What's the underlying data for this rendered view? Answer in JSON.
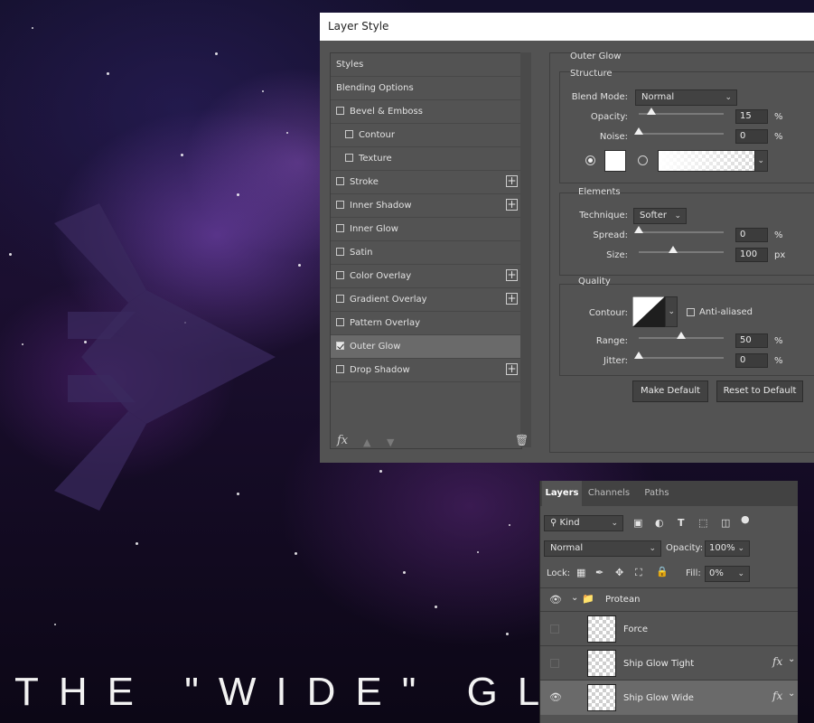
{
  "canvas": {
    "headline": "THE \"WIDE\" GLOW"
  },
  "layer_style": {
    "window_title": "Layer Style",
    "styles_list": [
      {
        "label": "Styles",
        "checkbox": false,
        "checked": false,
        "plus": false,
        "indent": 0,
        "selected": false
      },
      {
        "label": "Blending Options",
        "checkbox": false,
        "checked": false,
        "plus": false,
        "indent": 0,
        "selected": false
      },
      {
        "label": "Bevel & Emboss",
        "checkbox": true,
        "checked": false,
        "plus": false,
        "indent": 0,
        "selected": false
      },
      {
        "label": "Contour",
        "checkbox": true,
        "checked": false,
        "plus": false,
        "indent": 1,
        "selected": false
      },
      {
        "label": "Texture",
        "checkbox": true,
        "checked": false,
        "plus": false,
        "indent": 1,
        "selected": false
      },
      {
        "label": "Stroke",
        "checkbox": true,
        "checked": false,
        "plus": true,
        "indent": 0,
        "selected": false
      },
      {
        "label": "Inner Shadow",
        "checkbox": true,
        "checked": false,
        "plus": true,
        "indent": 0,
        "selected": false
      },
      {
        "label": "Inner Glow",
        "checkbox": true,
        "checked": false,
        "plus": false,
        "indent": 0,
        "selected": false
      },
      {
        "label": "Satin",
        "checkbox": true,
        "checked": false,
        "plus": false,
        "indent": 0,
        "selected": false
      },
      {
        "label": "Color Overlay",
        "checkbox": true,
        "checked": false,
        "plus": true,
        "indent": 0,
        "selected": false
      },
      {
        "label": "Gradient Overlay",
        "checkbox": true,
        "checked": false,
        "plus": true,
        "indent": 0,
        "selected": false
      },
      {
        "label": "Pattern Overlay",
        "checkbox": true,
        "checked": false,
        "plus": false,
        "indent": 0,
        "selected": false
      },
      {
        "label": "Outer Glow",
        "checkbox": true,
        "checked": true,
        "plus": false,
        "indent": 0,
        "selected": true
      },
      {
        "label": "Drop Shadow",
        "checkbox": true,
        "checked": false,
        "plus": true,
        "indent": 0,
        "selected": false
      }
    ],
    "footer": {
      "fx_label": "fx",
      "up_icon": "arrow-up-icon",
      "down_icon": "arrow-down-icon",
      "trash_icon": "trash-icon"
    },
    "outer_glow": {
      "title": "Outer Glow",
      "structure": {
        "title": "Structure",
        "blend_mode_label": "Blend Mode:",
        "blend_mode_value": "Normal",
        "opacity_label": "Opacity:",
        "opacity_value": "15",
        "opacity_fraction": 0.15,
        "noise_label": "Noise:",
        "noise_value": "0",
        "noise_fraction": 0,
        "percent": "%",
        "color_mode": "solid",
        "glow_color": "#ffffff"
      },
      "elements": {
        "title": "Elements",
        "technique_label": "Technique:",
        "technique_value": "Softer",
        "spread_label": "Spread:",
        "spread_value": "0",
        "spread_fraction": 0,
        "size_label": "Size:",
        "size_value": "100",
        "size_fraction": 0.4,
        "percent": "%",
        "px": "px"
      },
      "quality": {
        "title": "Quality",
        "contour_label": "Contour:",
        "anti_aliased_label": "Anti-aliased",
        "anti_aliased_checked": false,
        "range_label": "Range:",
        "range_value": "50",
        "range_fraction": 0.5,
        "jitter_label": "Jitter:",
        "jitter_value": "0",
        "jitter_fraction": 0,
        "percent": "%"
      },
      "make_default_label": "Make Default",
      "reset_default_label": "Reset to Default"
    }
  },
  "layers_panel": {
    "tabs": [
      "Layers",
      "Channels",
      "Paths"
    ],
    "active_tab": "Layers",
    "filter_kind_label": "Kind",
    "blend_mode": "Normal",
    "opacity_label": "Opacity:",
    "opacity_value": "100%",
    "lock_label": "Lock:",
    "fill_label": "Fill:",
    "fill_value": "0%",
    "group_name": "Protean",
    "layers": [
      {
        "name": "Force",
        "visible": false,
        "fx": false,
        "selected": false
      },
      {
        "name": "Ship Glow Tight",
        "visible": false,
        "fx": true,
        "selected": false
      },
      {
        "name": "Ship Glow Wide",
        "visible": true,
        "fx": true,
        "selected": true
      }
    ],
    "fx_mark": "fx"
  }
}
